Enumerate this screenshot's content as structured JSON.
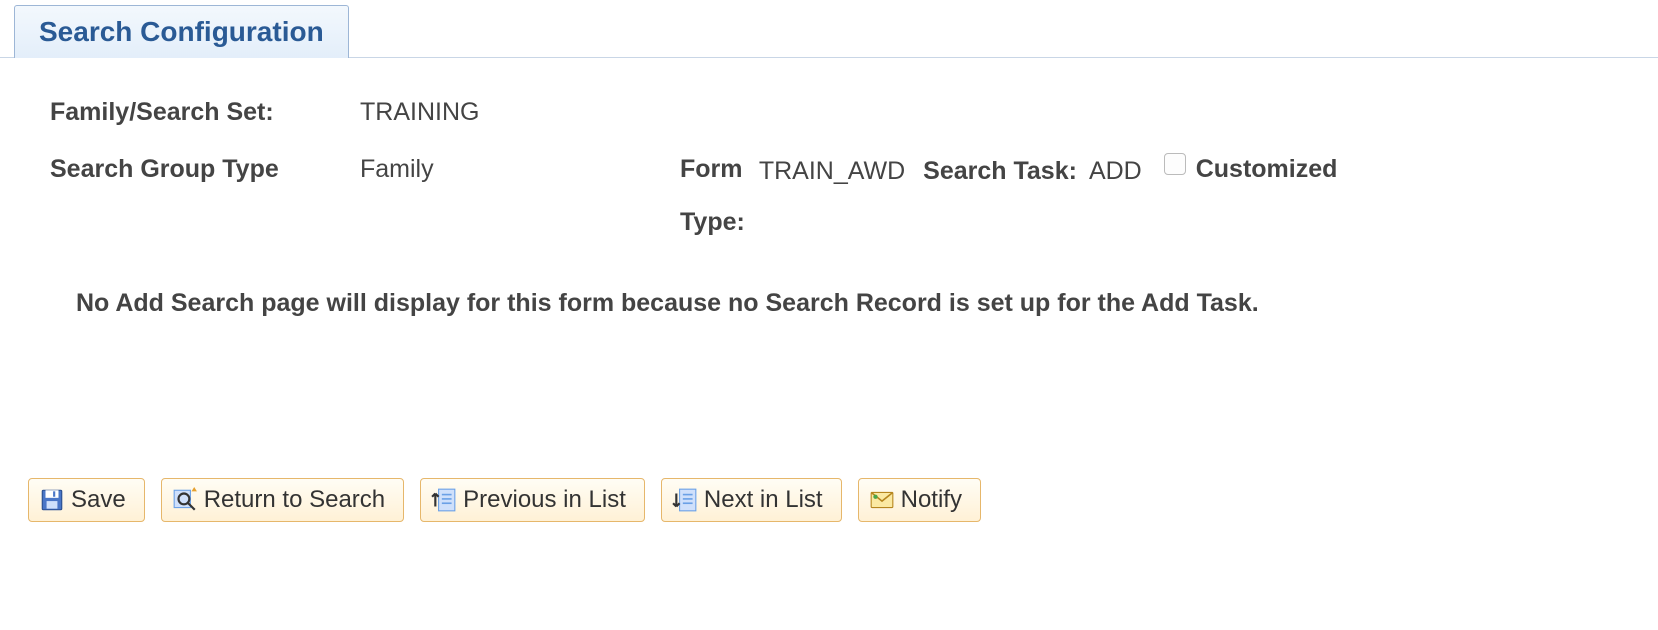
{
  "tab": {
    "label": "Search Configuration"
  },
  "fields": {
    "family_search_set": {
      "label": "Family/Search Set:",
      "value": "TRAINING"
    },
    "search_group_type": {
      "label": "Search Group Type",
      "value": "Family"
    },
    "form_type": {
      "label_line1": "Form",
      "label_line2": "Type:",
      "value": "TRAIN_AWD"
    },
    "search_task": {
      "label": "Search Task:",
      "value": "ADD"
    },
    "customized": {
      "label": "Customized",
      "checked": false
    }
  },
  "message": "No Add Search page will display for this form because no Search Record is set up for the Add Task.",
  "toolbar": {
    "save": "Save",
    "return_to_search": "Return to Search",
    "previous_in_list": "Previous in List",
    "next_in_list": "Next in List",
    "notify": "Notify"
  }
}
